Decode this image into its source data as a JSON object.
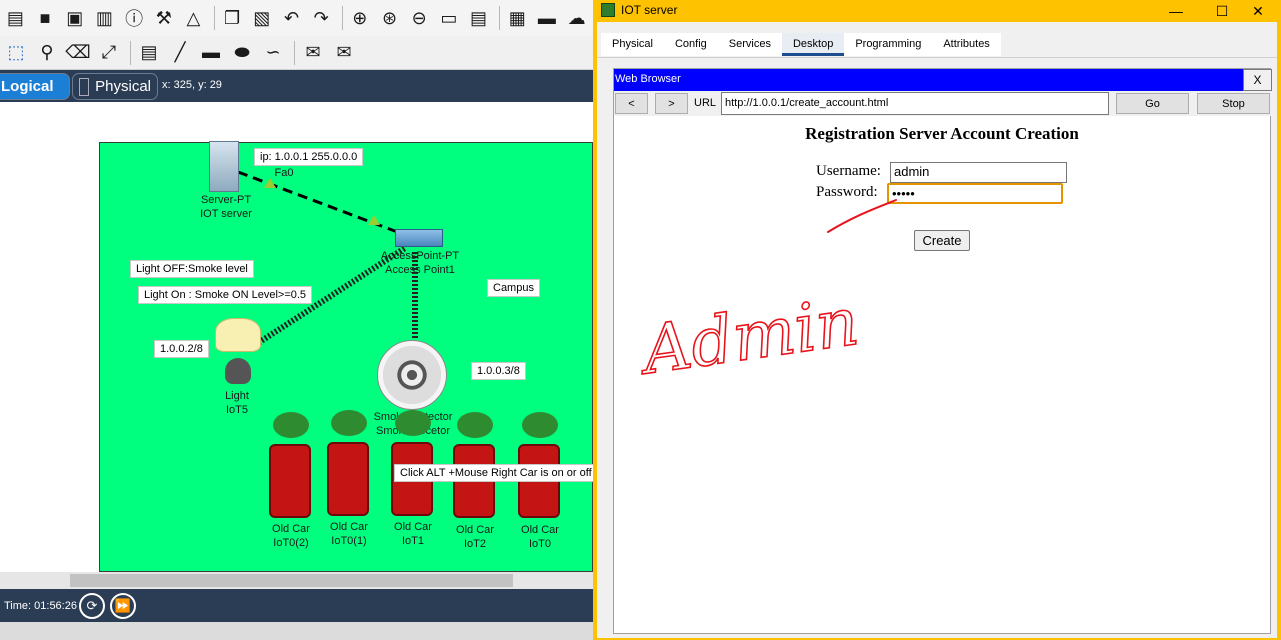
{
  "workspace": {
    "tab_logical": "Logical",
    "tab_physical": "Physical",
    "coordinates": "x: 325, y: 29",
    "time": "Time: 01:56:26",
    "area_label": "Campus",
    "device_labels": {
      "server": [
        "Server-PT",
        "IOT server"
      ],
      "access_point": [
        "AccessPoint-PT",
        "Access Point1"
      ],
      "light": [
        "Light",
        "IoT5"
      ],
      "smoke": [
        "Smoke Detector",
        "Smoke decetor"
      ],
      "car1": [
        "Old Car",
        "IoT0(2)"
      ],
      "car2": [
        "Old Car",
        "IoT0(1)"
      ],
      "car3": [
        "Old Car",
        "IoT1"
      ],
      "car4": [
        "Old Car",
        "IoT2"
      ],
      "car5": [
        "Old Car",
        "IoT0"
      ]
    },
    "notes": {
      "server_ip": "ip: 1.0.0.1 255.0.0.0",
      "port": "Fa0",
      "light_off": "Light OFF:Smoke level",
      "light_on": "Light On : Smoke ON Level>=0.5",
      "ip_light": "1.0.0.2/8",
      "ip_smoke": "1.0.0.3/8",
      "car_hint": "Click ALT +Mouse Right Car is on or off"
    }
  },
  "window": {
    "title": "IOT server",
    "tabs": [
      "Physical",
      "Config",
      "Services",
      "Desktop",
      "Programming",
      "Attributes"
    ],
    "active_tab": "Desktop"
  },
  "browser": {
    "title": "Web Browser",
    "close": "X",
    "back": "<",
    "forward": ">",
    "url_label": "URL",
    "url": "http://1.0.0.1/create_account.html",
    "go": "Go",
    "stop": "Stop"
  },
  "page": {
    "heading": "Registration Server Account Creation",
    "username_label": "Username:",
    "username_value": "admin",
    "password_label": "Password:",
    "password_value": "•••••",
    "create_button": "Create"
  },
  "annotation": {
    "handwritten": "Admin",
    "color": "#e8141b"
  },
  "colors": {
    "campus_bg": "#00ff7f",
    "window_frame": "#ffc200",
    "browser_header": "#0000ff",
    "workspace_bar": "#2b3d55"
  }
}
